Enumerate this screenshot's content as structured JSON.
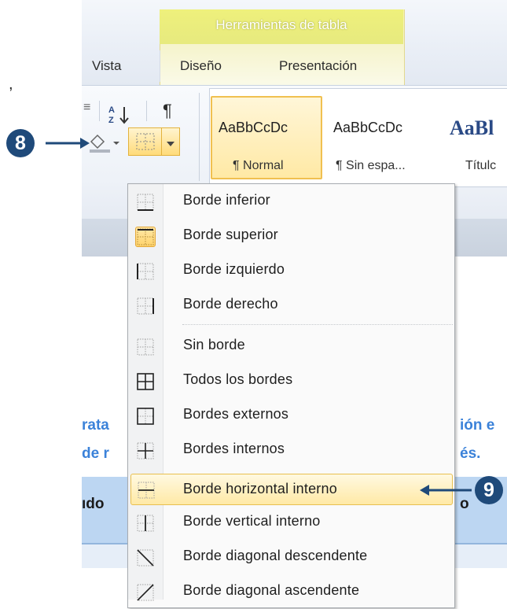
{
  "ribbon": {
    "context_title": "Herramientas de tabla",
    "tabs": [
      "Vista",
      "Diseño",
      "Presentación"
    ],
    "styles": [
      {
        "sample": "AaBbCcDc",
        "name": "¶ Normal"
      },
      {
        "sample": "AaBbCcDc",
        "name": "¶ Sin espa..."
      },
      {
        "sample": "AaBl",
        "name": "Títulc"
      }
    ]
  },
  "tools": {
    "sort_glyph": "A↓",
    "pilcrow": "¶",
    "fragment_left": "≡"
  },
  "menu": {
    "items": [
      {
        "label": "Borde inferior"
      },
      {
        "label": "Borde superior"
      },
      {
        "label": "Borde izquierdo"
      },
      {
        "label": "Borde derecho"
      },
      {
        "label": "Sin borde"
      },
      {
        "label": "Todos los bordes"
      },
      {
        "label": "Bordes externos"
      },
      {
        "label": "Bordes internos"
      },
      {
        "label": "Borde horizontal interno"
      },
      {
        "label": "Borde vertical interno"
      },
      {
        "label": "Borde diagonal descendente"
      },
      {
        "label": "Borde diagonal ascendente"
      }
    ]
  },
  "document": {
    "line1_left": "rata",
    "line1_right": "ión e",
    "line2_left": "de r",
    "line2_right": "és.",
    "header_left": "ıdo",
    "header_right": "o"
  },
  "callouts": {
    "step8": "8",
    "step9": "9"
  },
  "stray_mark": ","
}
